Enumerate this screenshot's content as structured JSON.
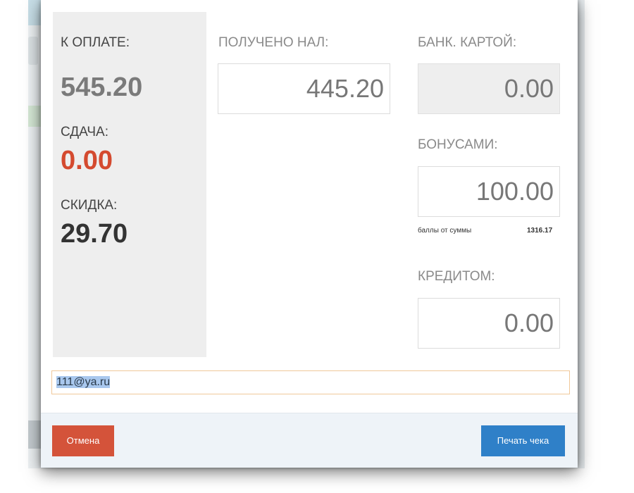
{
  "summary": {
    "to_pay_label": "К ОПЛАТЕ:",
    "to_pay_value": "545.20",
    "change_label": "СДАЧА:",
    "change_value": "0.00",
    "discount_label": "СКИДКА:",
    "discount_value": "29.70"
  },
  "cash": {
    "label": "ПОЛУЧЕНО НАЛ:",
    "value": "445.20"
  },
  "card": {
    "label": "БАНК. КАРТОЙ:",
    "value": "0.00"
  },
  "bonus": {
    "label": "БОНУСАМИ:",
    "value": "100.00",
    "points_label": "баллы от суммы",
    "points_value": "1316.17"
  },
  "credit": {
    "label": "КРЕДИТОМ:",
    "value": "0.00"
  },
  "email": {
    "value": "111@ya.ru"
  },
  "footer": {
    "cancel_label": "Отмена",
    "print_label": "Печать чека"
  },
  "colors": {
    "change_red": "#d44a2f",
    "cancel_button": "#d4533a",
    "print_button": "#2f80c8"
  }
}
